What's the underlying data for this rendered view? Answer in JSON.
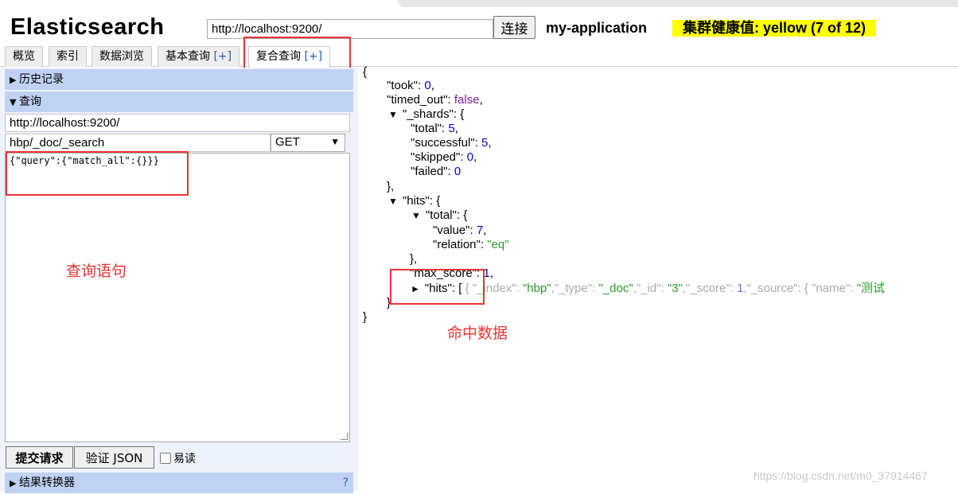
{
  "app": {
    "title": "Elasticsearch",
    "url": "http://localhost:9200/",
    "connect_label": "连接",
    "cluster_name": "my-application",
    "health": "集群健康值: yellow (7 of 12)",
    "health_color": "#ffff00"
  },
  "tabs": [
    {
      "label": "概览",
      "plus": ""
    },
    {
      "label": "索引",
      "plus": ""
    },
    {
      "label": "数据浏览",
      "plus": ""
    },
    {
      "label": "基本查询 ",
      "plus": "[+]"
    },
    {
      "label": "复合查询 ",
      "plus": "[+]"
    }
  ],
  "query_panel": {
    "history_label": "历史记录",
    "query_label": "查询",
    "base_url": "http://localhost:9200/",
    "path": "hbp/_doc/_search",
    "method": "GET",
    "body": "{\"query\":{\"match_all\":{}}}",
    "submit_label": "提交请求",
    "validate_label": "验证 JSON",
    "readable_label": "易读",
    "transformer_label": "结果转换器",
    "help": "?"
  },
  "annotations": {
    "query_statement": "查询语句",
    "hit_data": "命中数据",
    "color": "#e33333"
  },
  "response": {
    "open_brace": "{",
    "took_key": "\"took\"",
    "took_val": "0",
    "timed_out_key": "\"timed_out\"",
    "timed_out_val": "false",
    "shards_key": "\"_shards\"",
    "total_key": "\"total\"",
    "total_val": "5",
    "successful_key": "\"successful\"",
    "successful_val": "5",
    "skipped_key": "\"skipped\"",
    "skipped_val": "0",
    "failed_key": "\"failed\"",
    "failed_val": "0",
    "hits_key": "\"hits\"",
    "hits_total_key": "\"total\"",
    "value_key": "\"value\"",
    "value_val": "7",
    "relation_key": "\"relation\"",
    "relation_val": "\"eq\"",
    "max_score_key": "\"max_score\"",
    "max_score_val": "1",
    "inner_hits_key": "\"hits\"",
    "index_key": "\"_index\"",
    "index_val": "\"hbp\"",
    "type_key": "\"_type\"",
    "type_val": "\"_doc\"",
    "id_key": "\"_id\"",
    "id_val": "\"3\"",
    "score_key": "\"_score\"",
    "score_val": "1",
    "source_key": "\"_source\"",
    "name_key": "\"name\"",
    "name_val": "\"测试",
    "close_brace": "}"
  },
  "watermark": "https://blog.csdn.net/m0_37914467"
}
